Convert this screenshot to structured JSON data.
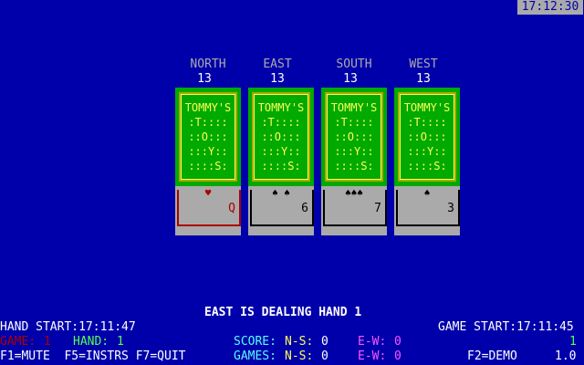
{
  "clock": "17:12:30",
  "seats": [
    {
      "name": "NORTH",
      "count": "13",
      "back": [
        "TOMMY'S",
        ":T::::",
        "::O:::",
        ":::Y::",
        "::::S:"
      ],
      "pips": "♥",
      "rank": "Q"
    },
    {
      "name": "EAST",
      "count": "13",
      "back": [
        "TOMMY'S",
        ":T::::",
        "::O:::",
        ":::Y::",
        "::::S:"
      ],
      "pips": "♠ ♠",
      "rank": "6"
    },
    {
      "name": "SOUTH",
      "count": "13",
      "back": [
        "TOMMY'S",
        ":T::::",
        "::O:::",
        ":::Y::",
        "::::S:"
      ],
      "pips": "♠♠♠",
      "rank": "7"
    },
    {
      "name": "WEST",
      "count": "13",
      "back": [
        "TOMMY'S",
        ":T::::",
        "::O:::",
        ":::Y::",
        "::::S:"
      ],
      "pips": "♠",
      "rank": "3"
    }
  ],
  "message": "EAST IS DEALING HAND 1",
  "hand_start": "HAND START:17:11:47",
  "game_start": "GAME START:17:11:45",
  "game_label": "GAME:",
  "game_value": "1",
  "hand_label": "HAND:",
  "hand_value": "1",
  "right_value": "1",
  "score_label": "SCORE:",
  "games_label": "GAMES:",
  "ns_label": "N-S:",
  "ew_label": "E-W:",
  "score_ns": "0",
  "score_ew": "0",
  "games_ns": "0",
  "games_ew": "0",
  "keys_left": "F1=MUTE  F5=INSTRS F7=QUIT",
  "keys_right": "F2=DEMO",
  "version": "1.0",
  "colors": {
    "background": "#0000aa",
    "card_green": "#00aa00",
    "card_yellow": "#ffff55",
    "gray": "#aaaaaa",
    "red": "#aa0000",
    "bright_green": "#55ff55",
    "cyan": "#55ffff",
    "magenta": "#ff55ff",
    "yellow": "#ffff55",
    "white": "#ffffff"
  }
}
